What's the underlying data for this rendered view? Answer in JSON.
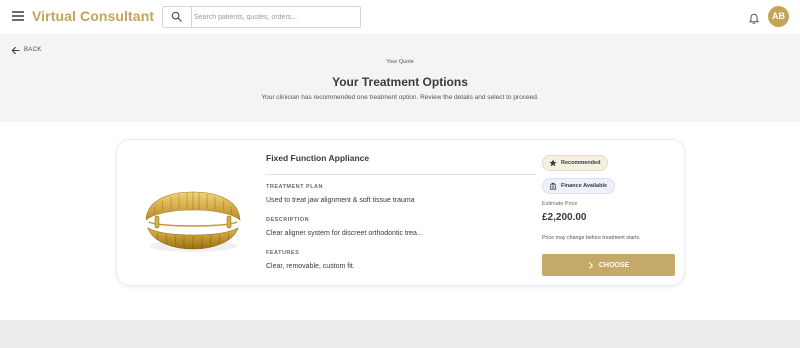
{
  "app": {
    "brand": "Virtual Consultant"
  },
  "search": {
    "placeholder": "Search patients, quotes, orders..."
  },
  "user": {
    "initials": "AB"
  },
  "nav": {
    "back_label": "BACK"
  },
  "hero": {
    "eyebrow": "Your Quote",
    "title": "Your Treatment Options",
    "subtitle": "Your clinician has recommended one treatment option. Review the details and select to proceed."
  },
  "option": {
    "title": "Fixed Function Appliance",
    "treatment_plan_label": "TREATMENT PLAN",
    "treatment_plan": "Used to treat jaw alignment & soft tissue trauma",
    "description_label": "DESCRIPTION",
    "description": "Clear aligner system for discreet orthodontic trea...",
    "features_label": "FEATURES",
    "features": "Clear, removable, custom fit.",
    "badge_recommended": "Recommended",
    "badge_finance": "Finance Available",
    "estimate_label": "Estimate Price",
    "price": "£2,200.00",
    "price_note": "Price may change before treatment starts.",
    "choose_label": "CHOOSE"
  },
  "colors": {
    "brand": "#c4a457",
    "button": "#c5a96a",
    "badge_gold": "#f5f0e2",
    "badge_blue": "#eef0fb"
  },
  "icons": [
    "menu-icon",
    "search-icon",
    "bell-icon",
    "arrow-left-icon",
    "star-icon",
    "bank-icon",
    "chevron-right-icon"
  ]
}
